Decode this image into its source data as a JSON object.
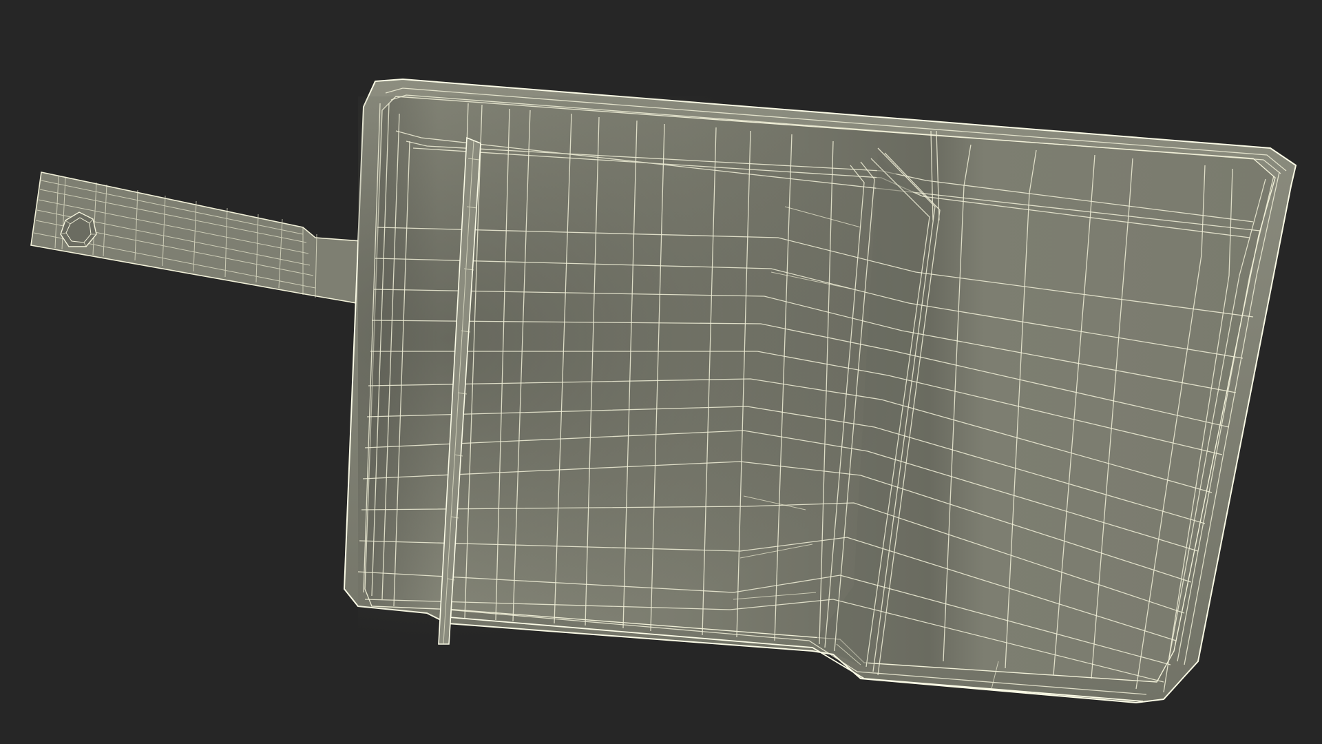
{
  "scene": {
    "background_color": "#262626",
    "object": "dustpan-wireframe-render",
    "mesh_fill_color": "#7a7b6e",
    "mesh_shadow_color": "#5c5d53",
    "wire_color": "#f1f0d8"
  }
}
